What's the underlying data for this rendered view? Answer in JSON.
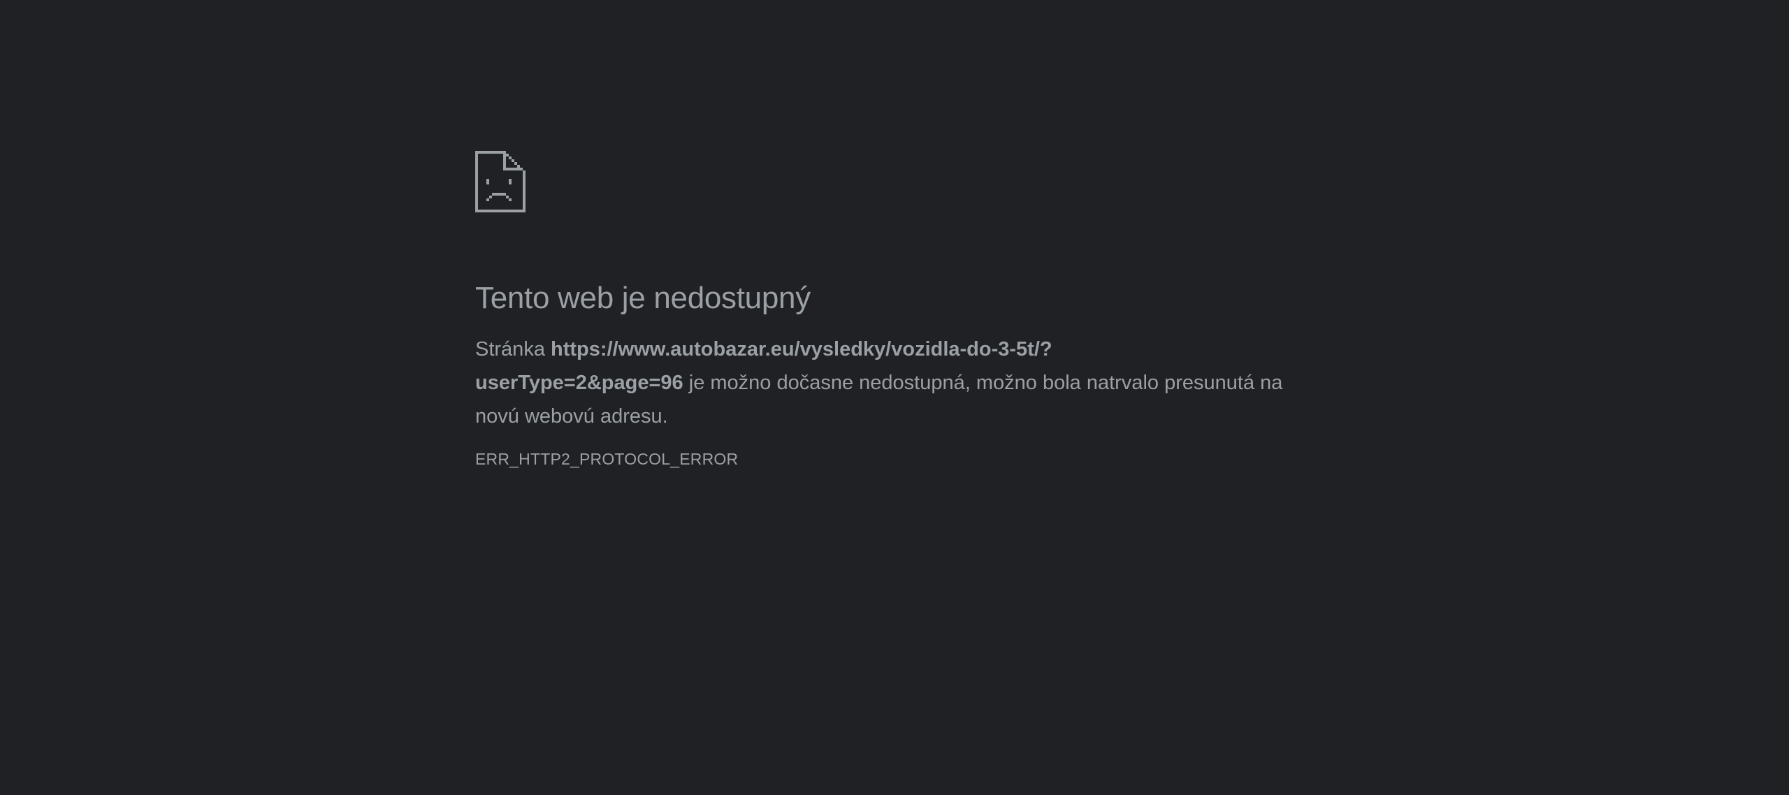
{
  "error_page": {
    "icon": "sad-page-icon",
    "title": "Tento web je nedostupný",
    "message_prefix": "Stránka ",
    "url_line1": "https://www.autobazar.eu/vysledky/vozidla-do-3-5t/?",
    "url_line2": "userType=2&page=96",
    "message_suffix": " je možno dočasne nedostupná, možno bola natrvalo presunutá na novú webovú adresu.",
    "error_code": "ERR_HTTP2_PROTOCOL_ERROR"
  },
  "colors": {
    "background": "#202124",
    "text": "#9aa0a6"
  }
}
